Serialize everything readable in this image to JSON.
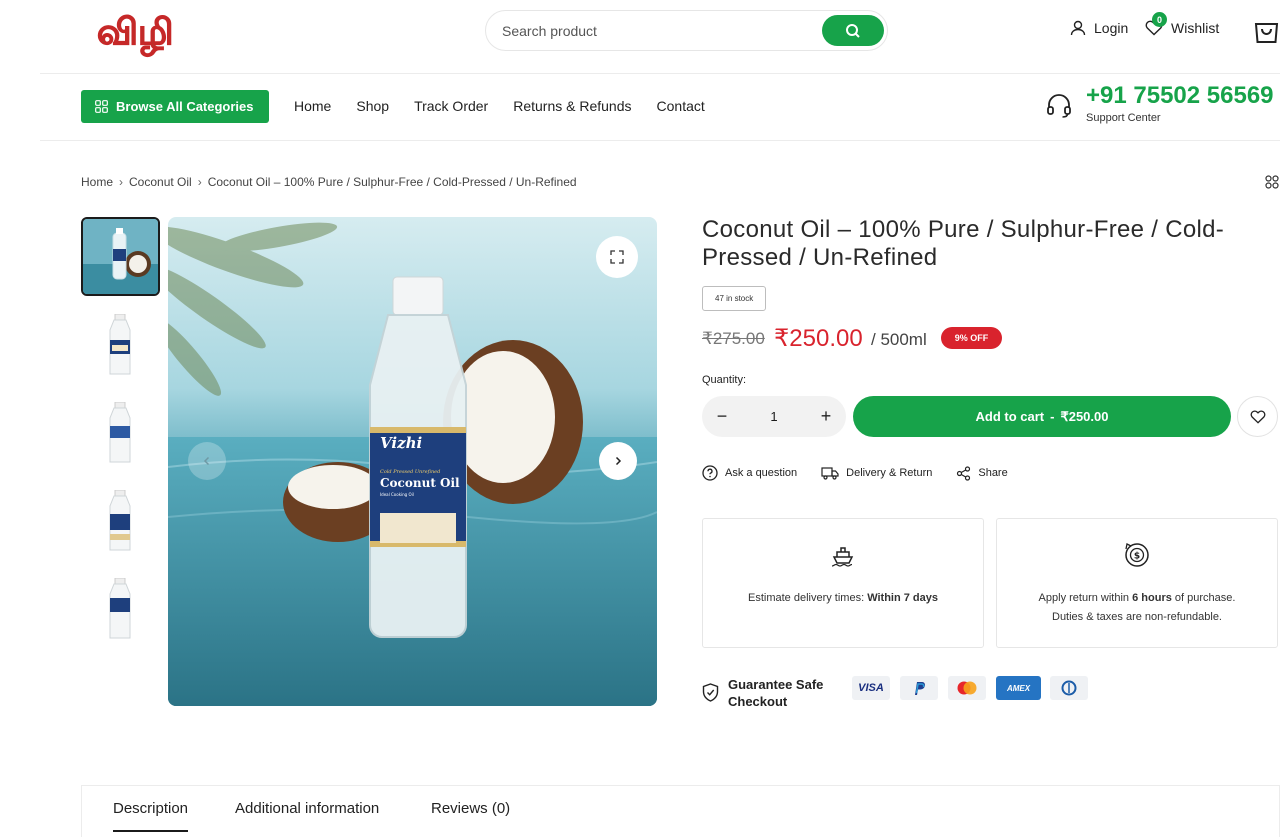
{
  "header": {
    "logo_text": "விழி",
    "search_placeholder": "Search product",
    "login_label": "Login",
    "wishlist_label": "Wishlist",
    "wishlist_count": "0"
  },
  "nav": {
    "browse_label": "Browse All Categories",
    "items": [
      "Home",
      "Shop",
      "Track Order",
      "Returns & Refunds",
      "Contact"
    ],
    "phone": "+91 75502 56569",
    "support_label": "Support Center"
  },
  "breadcrumb": [
    "Home",
    "Coconut Oil",
    "Coconut Oil – 100% Pure / Sulphur-Free / Cold-Pressed / Un-Refined"
  ],
  "product": {
    "title": "Coconut Oil – 100% Pure / Sulphur-Free / Cold-Pressed / Un-Refined",
    "stock": "47 in stock",
    "old_price": "₹275.00",
    "price": "₹250.00",
    "unit": "/ 500ml",
    "discount": "9% OFF",
    "quantity_label": "Quantity:",
    "quantity": "1",
    "add_to_cart_label": "Add to cart",
    "add_to_cart_sep": "-",
    "add_to_cart_price": "₹250.00",
    "bottle_brand": "Vizhi",
    "bottle_subtitle": "Cold Pressed Unrefined",
    "bottle_name": "Coconut Oil",
    "bottle_tag": "Ideal Cooking Oil"
  },
  "actions": {
    "ask": "Ask a question",
    "delivery": "Delivery & Return",
    "share": "Share"
  },
  "info": {
    "delivery_text": "Estimate delivery times:",
    "delivery_strong": "Within 7 days",
    "return_text_1": "Apply return within",
    "return_strong": "6 hours",
    "return_text_2": "of purchase.",
    "return_line2": "Duties & taxes are non-refundable."
  },
  "checkout": {
    "guarantee": "Guarantee Safe Checkout",
    "payments": [
      "VISA",
      "PayPal",
      "Mastercard",
      "AMEX",
      "Diners"
    ]
  },
  "tabs": [
    "Description",
    "Additional information",
    "Reviews (0)"
  ],
  "colors": {
    "brand_green": "#17a34a",
    "sale_red": "#d9232d"
  }
}
